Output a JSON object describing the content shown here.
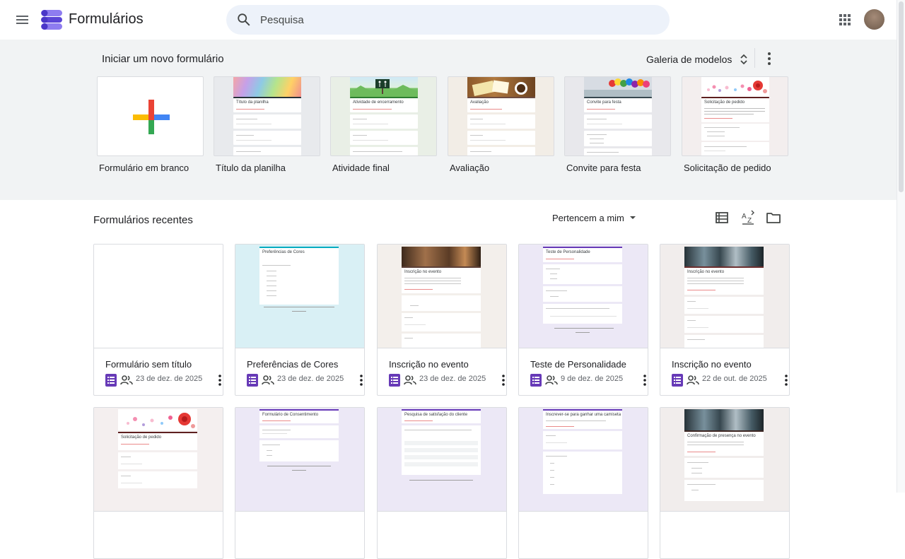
{
  "app": {
    "title": "Formulários"
  },
  "search": {
    "placeholder": "Pesquisa"
  },
  "templates": {
    "heading": "Iniciar um novo formulário",
    "gallery_label": "Galeria de modelos",
    "items": [
      {
        "label": "Formulário em branco",
        "thumb": "blank",
        "header_title": ""
      },
      {
        "label": "Título da planilha",
        "thumb": "colorful",
        "header_title": "Título da planilha"
      },
      {
        "label": "Atividade final",
        "thumb": "outdoor",
        "header_title": "Atividade de encerramento"
      },
      {
        "label": "Avaliação",
        "thumb": "coffee",
        "header_title": "Avaliação"
      },
      {
        "label": "Convite para festa",
        "thumb": "balloons",
        "header_title": "Convite para festa"
      },
      {
        "label": "Solicitação de pedido",
        "thumb": "floral",
        "header_title": "Solicitação de pedido"
      }
    ]
  },
  "recent": {
    "heading": "Formulários recentes",
    "owner_filter": "Pertencem a mim",
    "view_icons": [
      "list-view-icon",
      "sort-az-icon",
      "folder-icon"
    ],
    "cards": [
      {
        "title": "Formulário sem título",
        "date": "23 de dez. de 2025",
        "thumb": "blank",
        "preview_title": ""
      },
      {
        "title": "Preferências de Cores",
        "date": "23 de dez. de 2025",
        "thumb": "cyan",
        "preview_title": "Preferências de Cores"
      },
      {
        "title": "Inscrição no evento",
        "date": "23 de dez. de 2025",
        "thumb": "event",
        "preview_title": "Inscrição no evento"
      },
      {
        "title": "Teste de Personalidade",
        "date": "9 de dez. de 2025",
        "thumb": "purple",
        "preview_title": "Teste de Personalidade"
      },
      {
        "title": "Inscrição no evento",
        "date": "22 de out. de 2025",
        "thumb": "event",
        "preview_title": "Inscrição no evento"
      },
      {
        "title": "",
        "date": "",
        "thumb": "floral",
        "preview_title": "Solicitação de pedido"
      },
      {
        "title": "",
        "date": "",
        "thumb": "purple",
        "preview_title": "Formulário de Consentimento"
      },
      {
        "title": "",
        "date": "",
        "thumb": "purple",
        "preview_title": "Pesquisa de satisfação do cliente"
      },
      {
        "title": "",
        "date": "",
        "thumb": "purple",
        "preview_title": "Inscrever-se para ganhar uma camiseta"
      },
      {
        "title": "",
        "date": "",
        "thumb": "event",
        "preview_title": "Confirmação de presença no evento"
      }
    ]
  },
  "colors": {
    "forms_purple": "#673ab7",
    "template_bg": "#f1f3f4",
    "search_bg": "#edf2fa"
  }
}
